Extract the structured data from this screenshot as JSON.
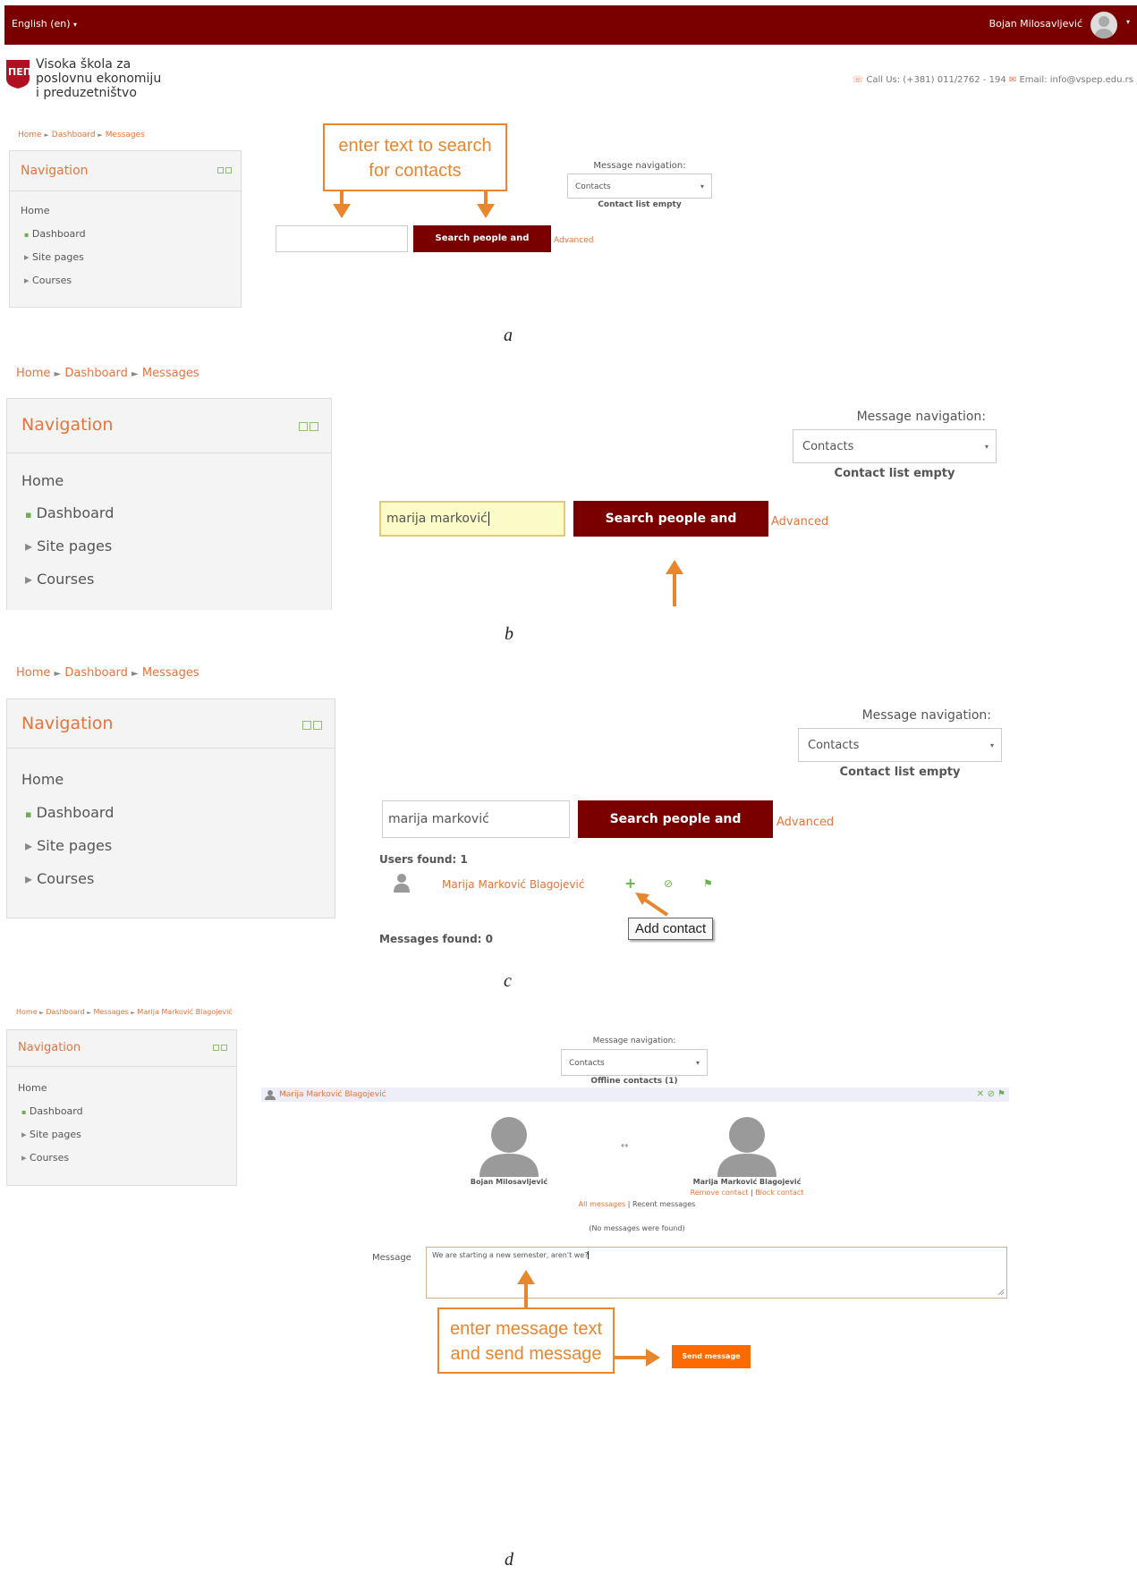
{
  "topbar": {
    "language": "English (en)",
    "language_caret": "▾",
    "user": "Bojan Milosavljević",
    "user_caret": "▾"
  },
  "logo": {
    "line1": "Visoka škola za",
    "line2": "poslovnu ekonomiju",
    "line3": "i preduzetništvo",
    "mark": "ПЕП"
  },
  "contact": {
    "call": "Call Us: (+381) 011/2762 - 194",
    "email": "Email: info@vspep.edu.rs"
  },
  "breadcrumb": {
    "home": "Home",
    "dashboard": "Dashboard",
    "messages": "Messages",
    "contact": "Marija Marković Blagojević",
    "sep": "►"
  },
  "navigation": {
    "title": "Navigation",
    "home": "Home",
    "dashboard": "Dashboard",
    "site_pages": "Site pages",
    "courses": "Courses",
    "dot": "▪",
    "tri": "▸"
  },
  "message_nav": {
    "label": "Message navigation:",
    "selected": "Contacts",
    "contact_list_empty": "Contact list empty",
    "offline_contacts": "Offline contacts (1)"
  },
  "search": {
    "button": "Search people and messages",
    "advanced": "Advanced",
    "query": "marija marković"
  },
  "annotations": {
    "a_callout_line1": "enter text to search",
    "a_callout_line2": "for contacts",
    "d_callout_line1": "enter message text",
    "d_callout_line2": "and send message"
  },
  "results": {
    "users_found": "Users found: 1",
    "user_name": "Marija Marković Blagojević",
    "messages_found": "Messages found: 0",
    "tooltip": "Add contact",
    "add_icon": "+",
    "block_icon": "⊘",
    "flag_icon": "⚑"
  },
  "conversation": {
    "contact_name": "Marija Marković Blagojević",
    "close_icon": "✕",
    "block_icon": "⊘",
    "flag_icon": "⚑",
    "me": "Bojan Milosavljević",
    "them": "Marija Marković Blagojević",
    "arrow": "↔",
    "remove_contact": "Remove contact",
    "block_contact": "Block contact",
    "pipe": "|",
    "all_messages": "All messages",
    "recent_messages": "Recent messages",
    "no_messages": "(No messages were found)",
    "message_label": "Message",
    "message_text": "We are starting a new semester, aren't we?",
    "send_button": "Send message"
  },
  "captions": {
    "a": "a",
    "b": "b",
    "c": "c",
    "d": "d"
  },
  "colors": {
    "brand": "#7a0000",
    "accent": "#e8733a",
    "annotation": "#e8862e",
    "success": "#6ab04c"
  }
}
